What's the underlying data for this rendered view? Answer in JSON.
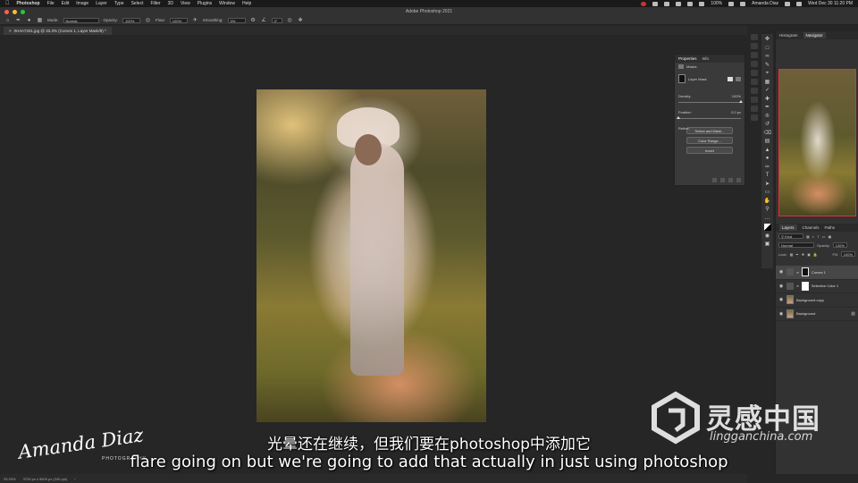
{
  "menubar": {
    "app": "Photoshop",
    "items": [
      "File",
      "Edit",
      "Image",
      "Layer",
      "Type",
      "Select",
      "Filter",
      "3D",
      "View",
      "Plugins",
      "Window",
      "Help"
    ],
    "battery": "100%",
    "user": "Amanda Diaz",
    "datetime": "Wed Dec 30 11:20 PM"
  },
  "window": {
    "title": "Adobe Photoshop 2021"
  },
  "options_bar": {
    "mode_label": "Mode:",
    "mode_value": "Normal",
    "opacity_label": "Opacity:",
    "opacity_value": "100%",
    "flow_label": "Flow:",
    "flow_value": "100%",
    "smoothing_label": "Smoothing:",
    "smoothing_value": "0%",
    "angle_value": "0°"
  },
  "document": {
    "tab_label": "0H4A7201.jpg @ 33.3% (Curves 1, Layer Mask/8) *"
  },
  "properties_panel": {
    "tabs": [
      "Properties",
      "Info"
    ],
    "section": "Masks",
    "mask_label": "Layer Mask",
    "density_label": "Density:",
    "density_value": "100%",
    "feather_label": "Feather:",
    "feather_value": "0.0 px",
    "refine_label": "Refine:",
    "buttons": [
      "Select and Mask...",
      "Color Range...",
      "Invert"
    ],
    "density_level": 1.0,
    "feather_level": 0.0
  },
  "navigator_panel": {
    "tabs": [
      "Histogram",
      "Navigator"
    ],
    "active_tab": "Navigator",
    "zoom": "33.33%"
  },
  "layers_panel": {
    "tabs": [
      "Layers",
      "Channels",
      "Paths"
    ],
    "filter_label": "Kind",
    "blend_mode": "Normal",
    "opacity_label": "Opacity:",
    "opacity_value": "100%",
    "lock_label": "Lock:",
    "fill_label": "Fill:",
    "fill_value": "100%",
    "layers": [
      {
        "name": "Curves 1",
        "type": "adjustment",
        "selected": true
      },
      {
        "name": "Selective Color 1",
        "type": "adjustment",
        "selected": false
      },
      {
        "name": "Background copy",
        "type": "pixel",
        "selected": false
      },
      {
        "name": "Background",
        "type": "pixel",
        "selected": false,
        "locked": true
      }
    ]
  },
  "status_bar": {
    "zoom": "33.33%",
    "dimensions": "3733 px x 5600 px (240 ppi)"
  },
  "subtitles": {
    "chinese": "光晕还在继续，但我们要在photoshop中添加它",
    "english": "flare going on but we're going to add that actually in just using photoshop"
  },
  "watermark": {
    "brand": "灵感中国",
    "site": "lingganchina.com"
  },
  "signature": {
    "name": "Amanda Diaz",
    "subtitle": "PHOTOGRAPHY"
  },
  "colors": {
    "ui_dark": "#262626",
    "panel": "#323232",
    "selection_red": "#dd3333",
    "close_red": "#ff5f57",
    "minimize_yellow": "#febc2e",
    "zoom_green": "#28c840"
  }
}
